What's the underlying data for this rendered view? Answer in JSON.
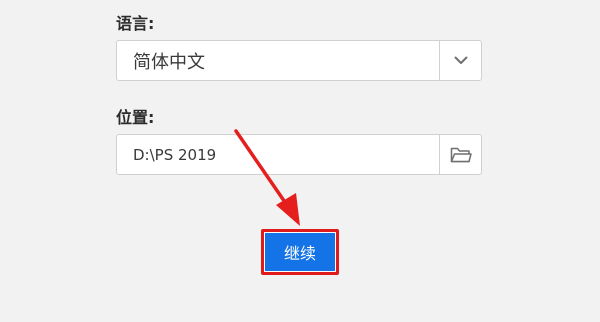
{
  "language": {
    "label": "语言:",
    "selected": "简体中文",
    "dropdown_icon": "chevron-down-icon"
  },
  "location": {
    "label": "位置:",
    "value": "D:\\PS 2019",
    "browse_icon": "folder-icon"
  },
  "actions": {
    "continue_label": "继续"
  },
  "colors": {
    "primary": "#1473e6",
    "highlight": "#e01b1b",
    "background": "#f2f2f2"
  }
}
